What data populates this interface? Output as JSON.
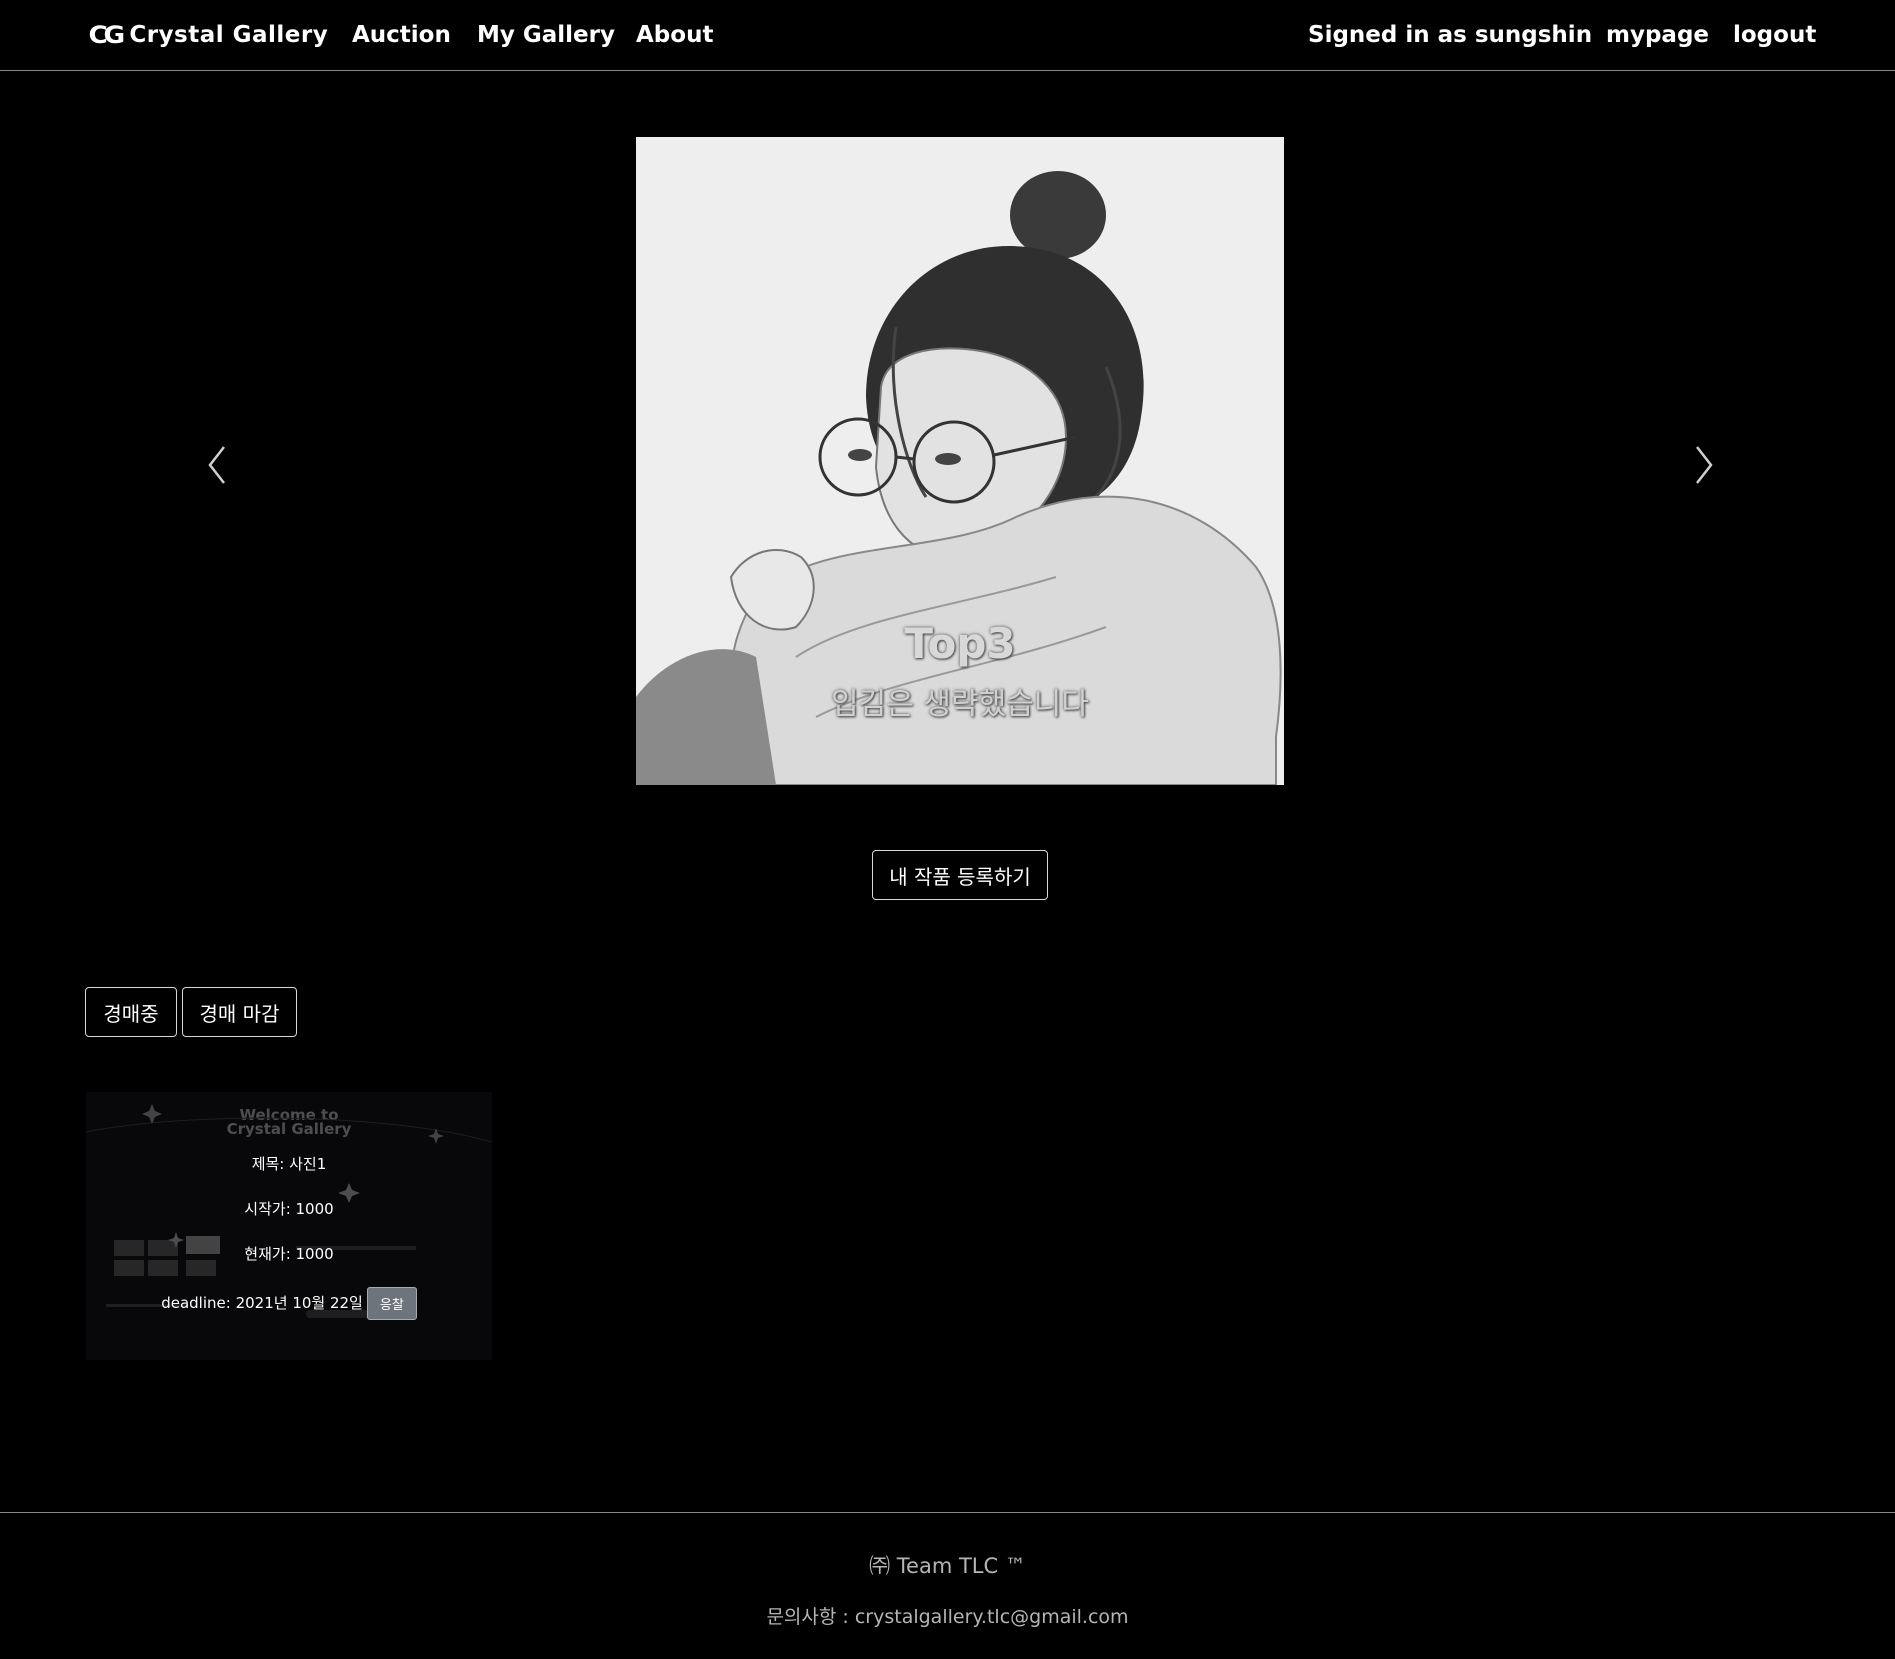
{
  "nav": {
    "brand_logo": "CG",
    "brand": "Crystal Gallery",
    "links": [
      "Auction",
      "My Gallery",
      "About"
    ],
    "signed_in": "Signed in as sungshin",
    "mypage": "mypage",
    "logout": "logout"
  },
  "carousel": {
    "caption_title": "Top3",
    "caption_subtitle": "입김은 생략했습니다"
  },
  "register_button": "내 작품 등록하기",
  "filters": [
    "경매중",
    "경매 마감"
  ],
  "card": {
    "thumb_title_line1": "Welcome to",
    "thumb_title_line2": "Crystal Gallery",
    "title": "제목: 사진1",
    "start_price": "시작가: 1000",
    "current_price": "현재가: 1000",
    "deadline": "deadline: 2021년 10월 22일",
    "bid_button": "응찰"
  },
  "footer": {
    "company": "㈜ Team TLC ™",
    "contact": "문의사항 : crystalgallery.tlc@gmail.com"
  }
}
